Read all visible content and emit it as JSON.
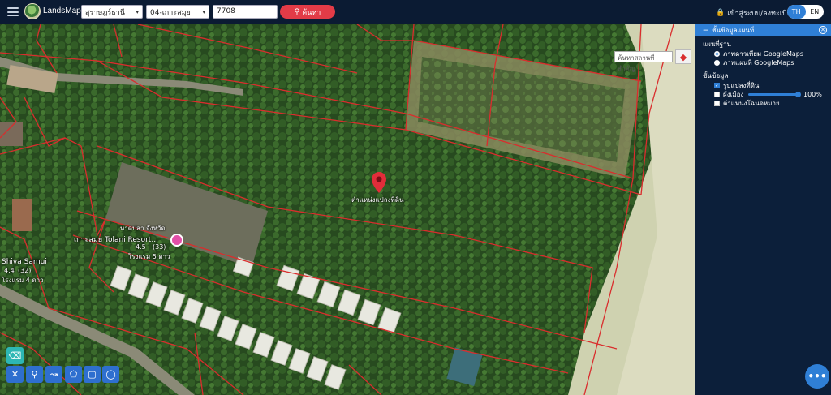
{
  "header": {
    "brand": "LandsMaps",
    "province": "สุราษฎร์ธานี",
    "district": "04-เกาะสมุย",
    "parcel_no": "7708",
    "search_label": "ค้นหา",
    "login_label": "เข้าสู่ระบบ/ลงทะเบียน",
    "lang_th": "TH",
    "lang_en": "EN"
  },
  "map": {
    "place_search_placeholder": "ค้นหาสถานที่สำคัญ",
    "marker_label": "ตำแหน่งแปลงที่ดิน",
    "poi": [
      {
        "name": "เกาะสมุย Tolani Resort...",
        "sub1": "หาดปลา จังหวัด",
        "sub2": "4.5",
        "sub3": "(33)",
        "sub4": "โรงแรม 5 ดาว"
      },
      {
        "name": "Shiva Samui",
        "sub2": "4.4",
        "sub3": "(32)",
        "sub4": "โรงแรม 4 ดาว"
      }
    ]
  },
  "panel": {
    "title": "ชั้นข้อมูลแผนที่",
    "basemap_heading": "แผนที่ฐาน",
    "basemap_options": [
      "ภาพดาวเทียม GoogleMaps",
      "ภาพแผนที่ GoogleMaps"
    ],
    "basemap_selected": 0,
    "layers_heading": "ชั้นข้อมูล",
    "layers": [
      {
        "label": "รูปแปลงที่ดิน",
        "checked": true
      },
      {
        "label": "ผังเมือง",
        "checked": false
      },
      {
        "label": "ตำแหน่งโฉนดหมาย",
        "checked": false
      }
    ],
    "opacity_label": "100%"
  },
  "toolbar": {
    "tools": [
      "measure-icon",
      "pin-icon",
      "polyline-icon",
      "polygon-icon",
      "rectangle-icon",
      "circle-icon"
    ]
  },
  "colors": {
    "accent": "#2f7fd6",
    "search": "#e23b47",
    "parcel_line": "#d92d2d",
    "header": "#0b1b33"
  }
}
